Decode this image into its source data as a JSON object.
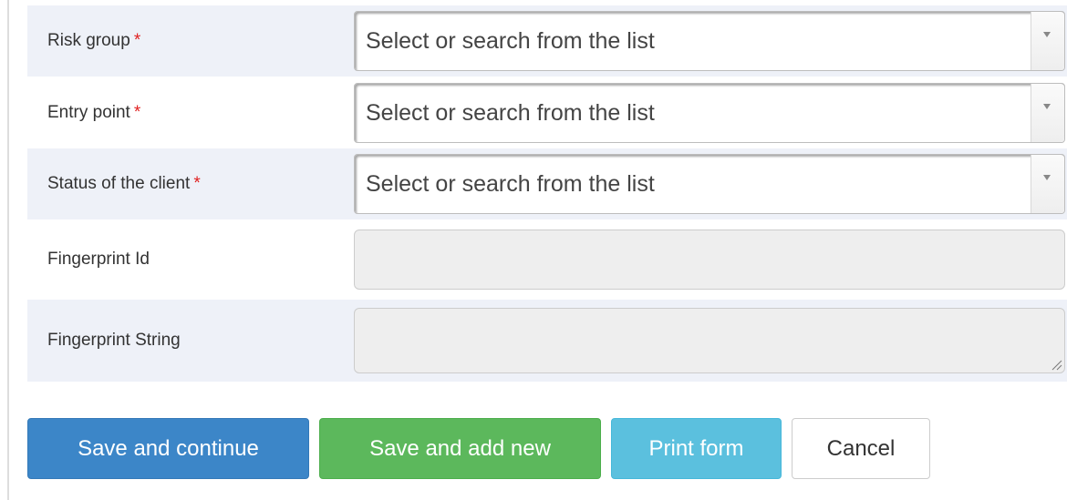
{
  "form": {
    "fields": [
      {
        "label": "Risk group",
        "required": "*",
        "type": "select",
        "placeholder": "Select or search from the list"
      },
      {
        "label": "Entry point",
        "required": "*",
        "type": "select",
        "placeholder": "Select or search from the list"
      },
      {
        "label": "Status of the client",
        "required": "*",
        "type": "select",
        "placeholder": "Select or search from the list"
      },
      {
        "label": "Fingerprint Id",
        "required": "",
        "type": "text",
        "value": ""
      },
      {
        "label": "Fingerprint String",
        "required": "",
        "type": "textarea",
        "value": ""
      }
    ]
  },
  "actions": {
    "save_continue": "Save and continue",
    "save_add_new": "Save and add new",
    "print_form": "Print form",
    "cancel": "Cancel"
  },
  "icons": {
    "dropdown": "chevron-down-icon",
    "resize": "resize-handle-icon"
  },
  "colors": {
    "row_shade": "#eef1f8",
    "required": "#e02020",
    "primary": "#3c86c8",
    "success": "#5cb85c",
    "info": "#5bc0de"
  }
}
